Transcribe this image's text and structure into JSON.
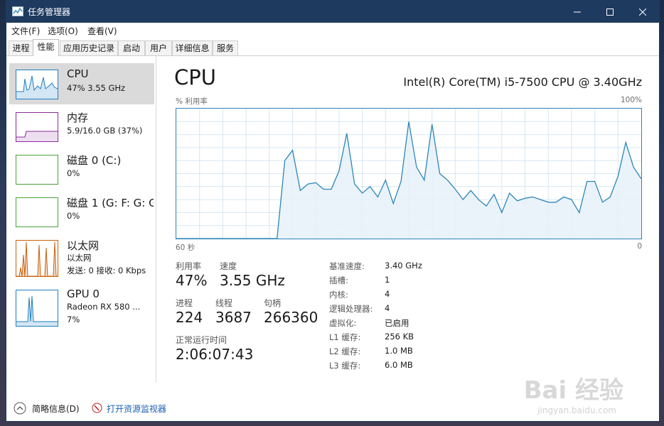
{
  "window": {
    "title": "任务管理器"
  },
  "menu": [
    "文件(F)",
    "选项(O)",
    "查看(V)"
  ],
  "tabs": [
    "进程",
    "性能",
    "应用历史记录",
    "启动",
    "用户",
    "详细信息",
    "服务"
  ],
  "active_tab": "性能",
  "sidebar": [
    {
      "name": "CPU",
      "sub": [
        "47% 3.55 GHz"
      ],
      "color": "#1f7fbf"
    },
    {
      "name": "内存",
      "sub": [
        "5.9/16.0 GB (37%)"
      ],
      "color": "#8b2b9a"
    },
    {
      "name": "磁盘 0 (C:)",
      "sub": [
        "0%"
      ],
      "color": "#4aa13a"
    },
    {
      "name": "磁盘 1 (G: F: G: G",
      "sub": [
        "0%"
      ],
      "color": "#4aa13a"
    },
    {
      "name": "以太网",
      "sub": [
        "以太网",
        "发送: 0 接收: 0 Kbps"
      ],
      "color": "#c8620d"
    },
    {
      "name": "GPU 0",
      "sub": [
        "Radeon RX 580 ...",
        "7%"
      ],
      "color": "#1f7fbf"
    }
  ],
  "main": {
    "title": "CPU",
    "model": "Intel(R) Core(TM) i5-7500 CPU @ 3.40GHz",
    "graph_label": "% 利用率",
    "graph_max": "100%",
    "graph_left": "60 秒",
    "graph_right": "0",
    "stats": {
      "util_label": "利用率",
      "util_value": "47%",
      "speed_label": "速度",
      "speed_value": "3.55 GHz",
      "proc_label": "进程",
      "proc_value": "224",
      "thread_label": "线程",
      "thread_value": "3687",
      "handle_label": "句柄",
      "handle_value": "266360",
      "uptime_label": "正常运行时间",
      "uptime_value": "2:06:07:43"
    },
    "details": [
      {
        "label": "基准速度:",
        "value": "3.40 GHz"
      },
      {
        "label": "插槽:",
        "value": "1"
      },
      {
        "label": "内核:",
        "value": "4"
      },
      {
        "label": "逻辑处理器:",
        "value": "4"
      },
      {
        "label": "虚拟化:",
        "value": "已启用"
      },
      {
        "label": "L1 缓存:",
        "value": "256 KB"
      },
      {
        "label": "L2 缓存:",
        "value": "1.0 MB"
      },
      {
        "label": "L3 缓存:",
        "value": "6.0 MB"
      }
    ]
  },
  "footer": {
    "fewer": "简略信息(D)",
    "monitor": "打开资源监视器"
  },
  "watermark": {
    "main": "Bai 经验",
    "sub": "jingyan.baidu.com"
  },
  "chart_data": {
    "type": "area",
    "x_range": [
      60,
      0
    ],
    "ylim": [
      0,
      100
    ],
    "series": [
      {
        "values": [
          0,
          0,
          0,
          0,
          0,
          0,
          0,
          0,
          0,
          0,
          0,
          0,
          0,
          0,
          60,
          68,
          37,
          42,
          43,
          38,
          38,
          52,
          81,
          42,
          35,
          40,
          32,
          45,
          27,
          44,
          90,
          55,
          45,
          88,
          50,
          45,
          38,
          30,
          37,
          30,
          25,
          34,
          20,
          35,
          29,
          31,
          32,
          30,
          28,
          28,
          32,
          30,
          20,
          44,
          44,
          28,
          32,
          48,
          74,
          55,
          46
        ]
      }
    ],
    "colors": {
      "line": "#2c86b8",
      "fill": "#e6f1f8",
      "grid": "#d6e7f2"
    }
  }
}
